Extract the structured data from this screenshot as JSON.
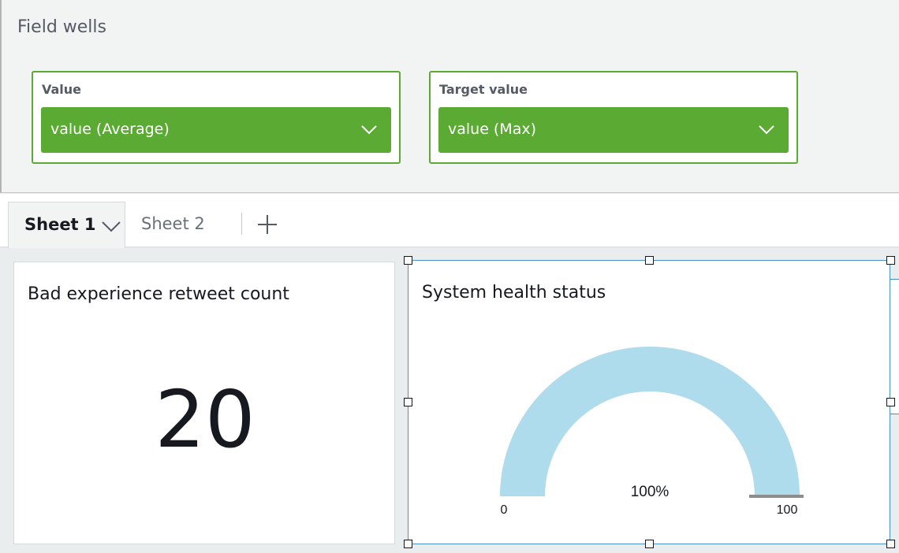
{
  "field_wells": {
    "title": "Field wells",
    "wells": [
      {
        "label": "Value",
        "field": "value (Average)"
      },
      {
        "label": "Target value",
        "field": "value (Max)"
      }
    ]
  },
  "tabs": {
    "active": "Sheet 1",
    "other": "Sheet 2"
  },
  "visuals": {
    "kpi": {
      "title": "Bad experience retweet count",
      "value": "20"
    },
    "gauge": {
      "title": "System health status",
      "percent_label": "100%",
      "min_label": "0",
      "max_label": "100",
      "value": 100,
      "min": 0,
      "max": 100
    }
  },
  "colors": {
    "well_green": "#5aaa33",
    "gauge_fill": "#aedcec",
    "selection_blue": "#4a90c2",
    "target_marker": "#8d8d8d"
  }
}
